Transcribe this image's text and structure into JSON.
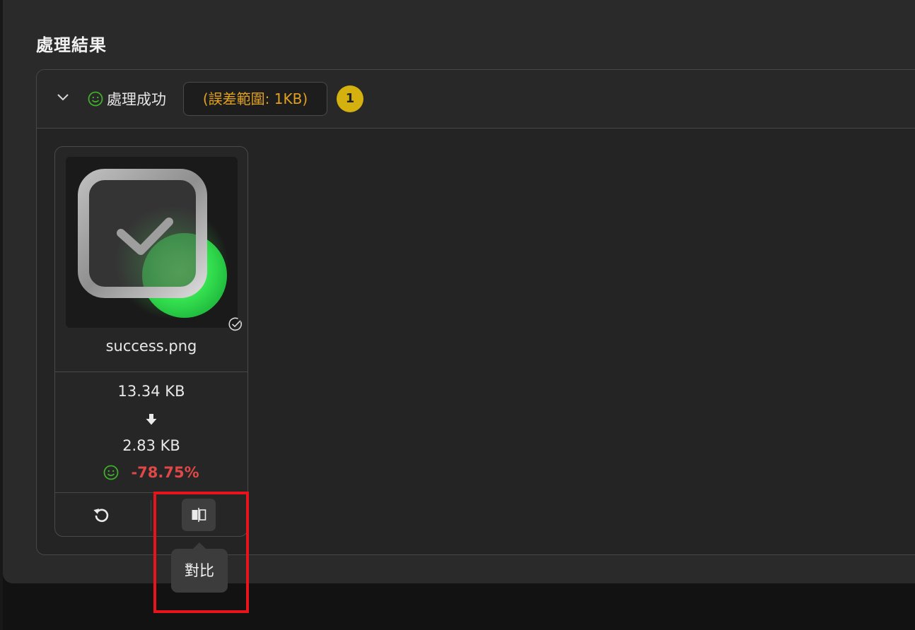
{
  "section": {
    "title": "處理結果"
  },
  "group": {
    "status_label": "處理成功",
    "tolerance_chip": "(誤差範圍: 1KB)",
    "count_badge": "1",
    "status_color": "#3fae2a",
    "chip_text_color": "#e0a020",
    "badge_color": "#d4b10e"
  },
  "file_card": {
    "filename": "success.png",
    "original_size": "13.34 KB",
    "compressed_size": "2.83 KB",
    "ratio": "-78.75%",
    "ratio_color": "#e04848",
    "thumbnail_icon": "checkbox-check-green-dot",
    "done_icon": "check-circle-icon"
  },
  "actions": {
    "reset_icon": "rotate-ccw-icon",
    "compare_icon": "compare-split-icon"
  },
  "tooltip": {
    "text": "對比"
  },
  "highlight_color": "#e8141c"
}
